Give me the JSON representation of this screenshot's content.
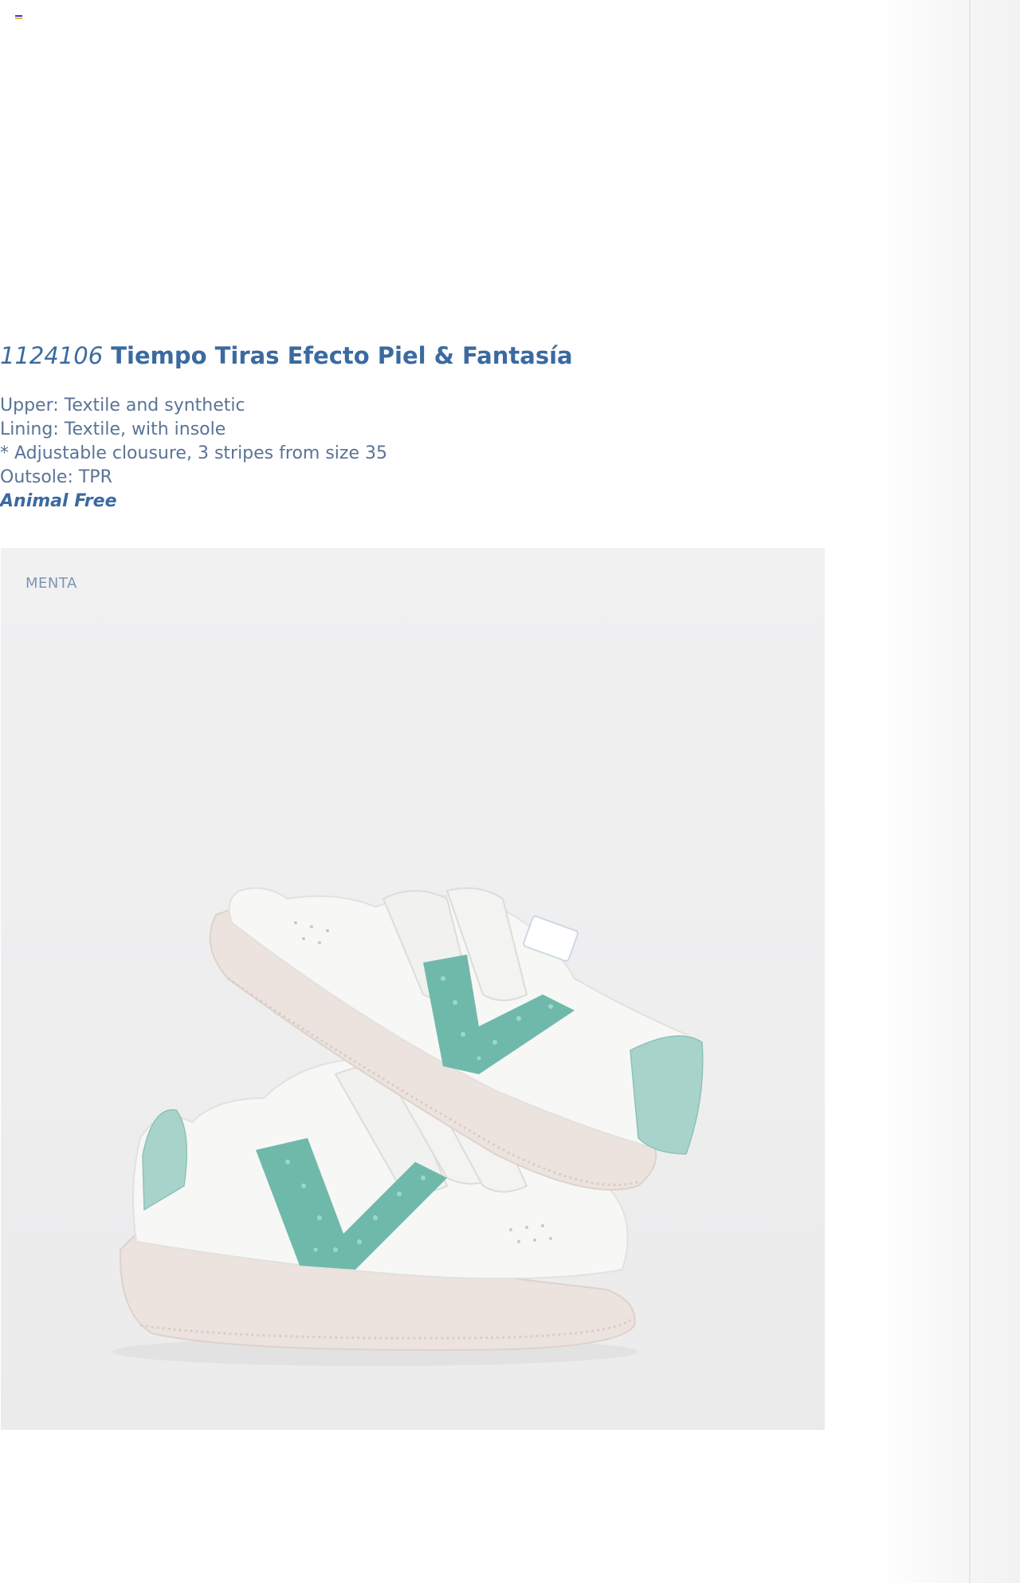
{
  "header": {
    "menu_icon": "menu-icon",
    "menu_icon_colors": [
      "#3b3b9c",
      "#d4b85a"
    ]
  },
  "product": {
    "code": "1124106",
    "name": "Tiempo Tiras Efecto Piel & Fantasía",
    "specs": [
      "Upper: Textile and synthetic",
      "Lining: Textile, with insole",
      "* Adjustable clousure, 3 stripes from size 35",
      "Outsole: TPR"
    ],
    "badge": "Animal Free",
    "color_name": "MENTA",
    "image_icon": "sneakers-pair-image"
  },
  "colors": {
    "text_primary": "#3b6aa0",
    "text_secondary": "#5a7396",
    "accent_glitter": "#6fb9ab",
    "background_card": "#efeff0"
  }
}
